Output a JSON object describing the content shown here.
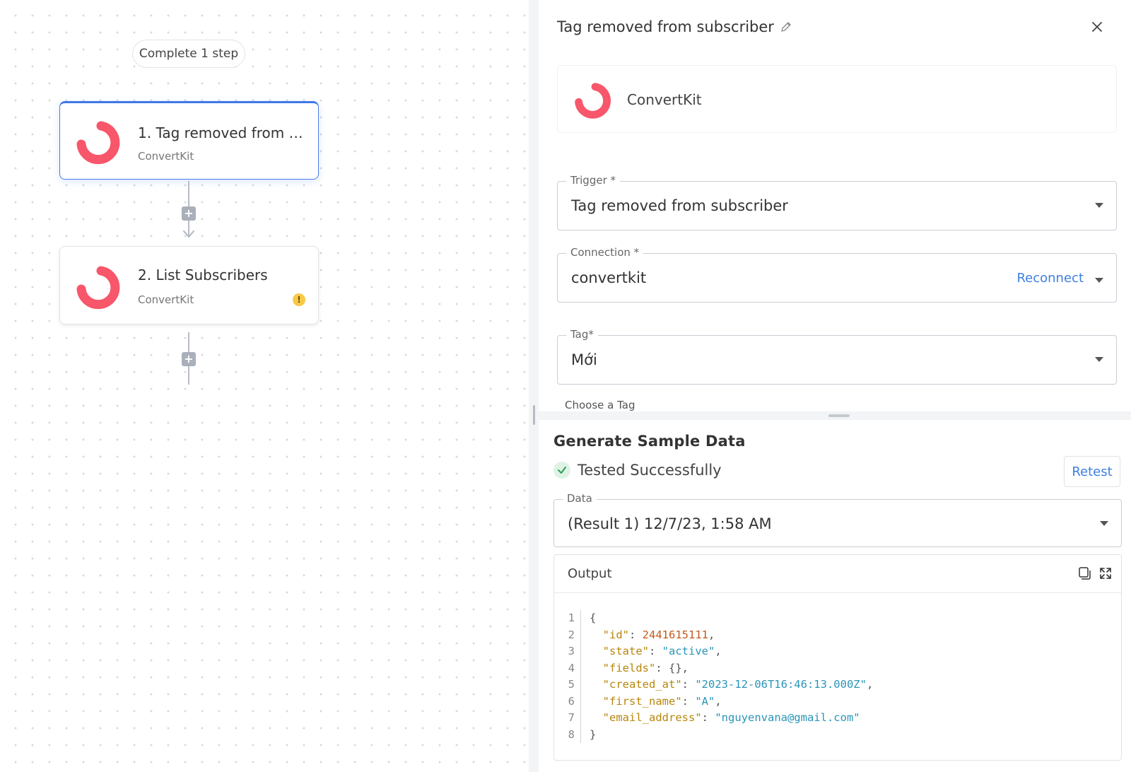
{
  "canvas": {
    "progress_label": "Complete 1 step",
    "steps": [
      {
        "title": "1. Tag removed from su...",
        "app": "ConvertKit"
      },
      {
        "title": "2. List Subscribers",
        "app": "ConvertKit",
        "warning": "!"
      }
    ]
  },
  "panel": {
    "title": "Tag removed from subscriber",
    "app_name": "ConvertKit",
    "trigger": {
      "label": "Trigger *",
      "value": "Tag removed from subscriber"
    },
    "connection": {
      "label": "Connection *",
      "value": "convertkit",
      "action": "Reconnect"
    },
    "tag": {
      "label": "Tag*",
      "value": "Mới",
      "helper": "Choose a Tag"
    }
  },
  "sample": {
    "title": "Generate Sample Data",
    "status": "Tested Successfully",
    "retest_label": "Retest",
    "data_label": "Data",
    "data_value": "(Result 1) 12/7/23, 1:58 AM",
    "output_label": "Output",
    "code_lines": [
      {
        "n": "1",
        "open": "{"
      },
      {
        "n": "2",
        "key": "\"id\"",
        "sep": ": ",
        "val": "2441615111",
        "vtype": "num",
        "end": ","
      },
      {
        "n": "3",
        "key": "\"state\"",
        "sep": ": ",
        "val": "\"active\"",
        "vtype": "str",
        "end": ","
      },
      {
        "n": "4",
        "key": "\"fields\"",
        "sep": ": ",
        "val": "{}",
        "vtype": "p",
        "end": ","
      },
      {
        "n": "5",
        "key": "\"created_at\"",
        "sep": ": ",
        "val": "\"2023-12-06T16:46:13.000Z\"",
        "vtype": "str",
        "end": ","
      },
      {
        "n": "6",
        "key": "\"first_name\"",
        "sep": ": ",
        "val": "\"A\"",
        "vtype": "str",
        "end": ","
      },
      {
        "n": "7",
        "key": "\"email_address\"",
        "sep": ": ",
        "val": "\"nguyenvana@gmail.com\"",
        "vtype": "str",
        "end": ""
      },
      {
        "n": "8",
        "open": "}"
      }
    ]
  },
  "colors": {
    "brand_logo": "#f8566a",
    "accent_blue": "#3d7fe0",
    "success_green": "#2e9d57",
    "warning_yellow": "#f7c948"
  },
  "icons": [
    "convertkit-logo-icon",
    "plus-icon",
    "arrow-down-icon",
    "warning-icon",
    "edit-pencil-icon",
    "close-icon",
    "chevron-down-icon",
    "check-circle-icon",
    "copy-icon",
    "expand-icon"
  ]
}
